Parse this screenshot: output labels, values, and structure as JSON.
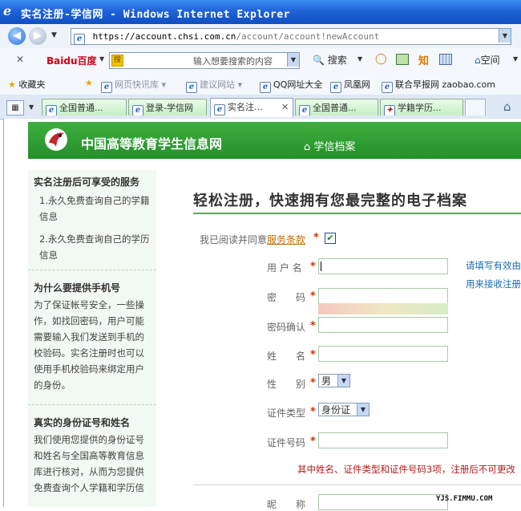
{
  "window": {
    "title": "实名注册-学信网 - Windows Internet Explorer",
    "address_host": "https://account.chsi.com.cn",
    "address_path": "/account/account!newAccount"
  },
  "toolbar": {
    "baidu": "Baidu百度",
    "search_placeholder": "输入想要搜索的内容",
    "search_button": "搜索",
    "zhi": "知",
    "space": "空间"
  },
  "favorites": {
    "favorites_label": "收藏夹",
    "items": [
      "网页快讯库",
      "建议网站",
      "QQ网址大全",
      "凤凰网",
      "联合早报网 zaobao.com"
    ]
  },
  "tabs": [
    "全国普通...",
    "登录-学信网",
    "实名注...",
    "全国普通...",
    "学籍学历..."
  ],
  "site": {
    "name": "中国高等教育学生信息网",
    "nav": "学信档案"
  },
  "sidebar": {
    "section1_title": "实名注册后可享受的服务",
    "item1": "1.永久免费查询自己的学籍信息",
    "item2": "2.永久免费查询自己的学历信息",
    "section2_title": "为什么要提供手机号",
    "section2_text": "为了保证帐号安全，一些操作，如找回密码，用户可能需要输入我们发送到手机的校验码。实名注册时也可以使用手机校验码来绑定用户的身份。",
    "section3_title": "真实的身份证号和姓名",
    "section3_text": "我们使用您提供的身份证号和姓名与全国高等教育信息库进行核对，从而为您提供免费查询个人学籍和学历信"
  },
  "form": {
    "heading": "轻松注册，快速拥有您最完整的电子档案",
    "agree_text": "我已阅读并同意",
    "agree_link": "服务条款",
    "agree_checked": true,
    "required_mark": "*",
    "username_label": "用 户 名",
    "password_label": "密　　码",
    "confirm_label": "密码确认",
    "name_label": "姓　　名",
    "gender_label": "性　　别",
    "gender_value": "男",
    "id_type_label": "证件类型",
    "id_type_value": "身份证",
    "id_number_label": "证件号码",
    "nickname_label": "昵　　称",
    "hint1": "请填写有效由",
    "hint2": "用来接收注册",
    "warning": "其中姓名、证件类型和证件号码3项，注册后不可更改"
  },
  "watermark": "YJS.FIMMU.COM"
}
